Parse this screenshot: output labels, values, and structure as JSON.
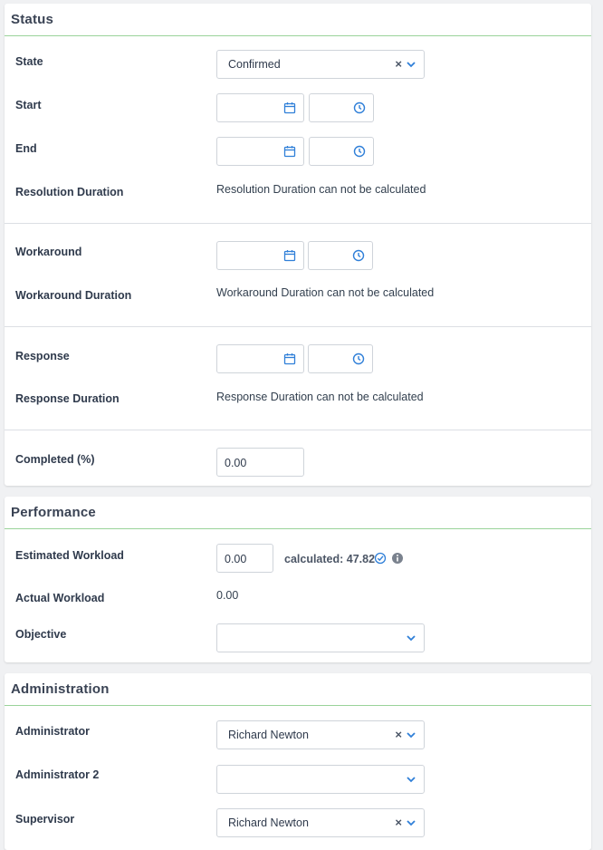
{
  "status": {
    "title": "Status",
    "state": {
      "label": "State",
      "value": "Confirmed"
    },
    "start": {
      "label": "Start"
    },
    "end": {
      "label": "End"
    },
    "resolution_duration": {
      "label": "Resolution Duration",
      "value": "Resolution Duration can not be calculated"
    },
    "workaround": {
      "label": "Workaround"
    },
    "workaround_duration": {
      "label": "Workaround Duration",
      "value": "Workaround Duration can not be calculated"
    },
    "response": {
      "label": "Response"
    },
    "response_duration": {
      "label": "Response Duration",
      "value": "Response Duration can not be calculated"
    },
    "completed": {
      "label": "Completed (%)",
      "value": "0.00"
    }
  },
  "performance": {
    "title": "Performance",
    "estimated_workload": {
      "label": "Estimated Workload",
      "value": "0.00",
      "calculated": "calculated: 47.82"
    },
    "actual_workload": {
      "label": "Actual Workload",
      "value": "0.00"
    },
    "objective": {
      "label": "Objective",
      "value": ""
    }
  },
  "administration": {
    "title": "Administration",
    "administrator": {
      "label": "Administrator",
      "value": "Richard Newton"
    },
    "administrator2": {
      "label": "Administrator 2",
      "value": ""
    },
    "supervisor": {
      "label": "Supervisor",
      "value": "Richard Newton"
    }
  },
  "icons": {
    "calendar": "calendar-icon",
    "clock": "clock-icon",
    "chevron": "chevron-down-icon",
    "clear": "clear-icon",
    "check": "check-circle-icon",
    "info": "info-icon"
  },
  "colors": {
    "accent": "#2f7fd8",
    "divider": "#9ad39a"
  }
}
